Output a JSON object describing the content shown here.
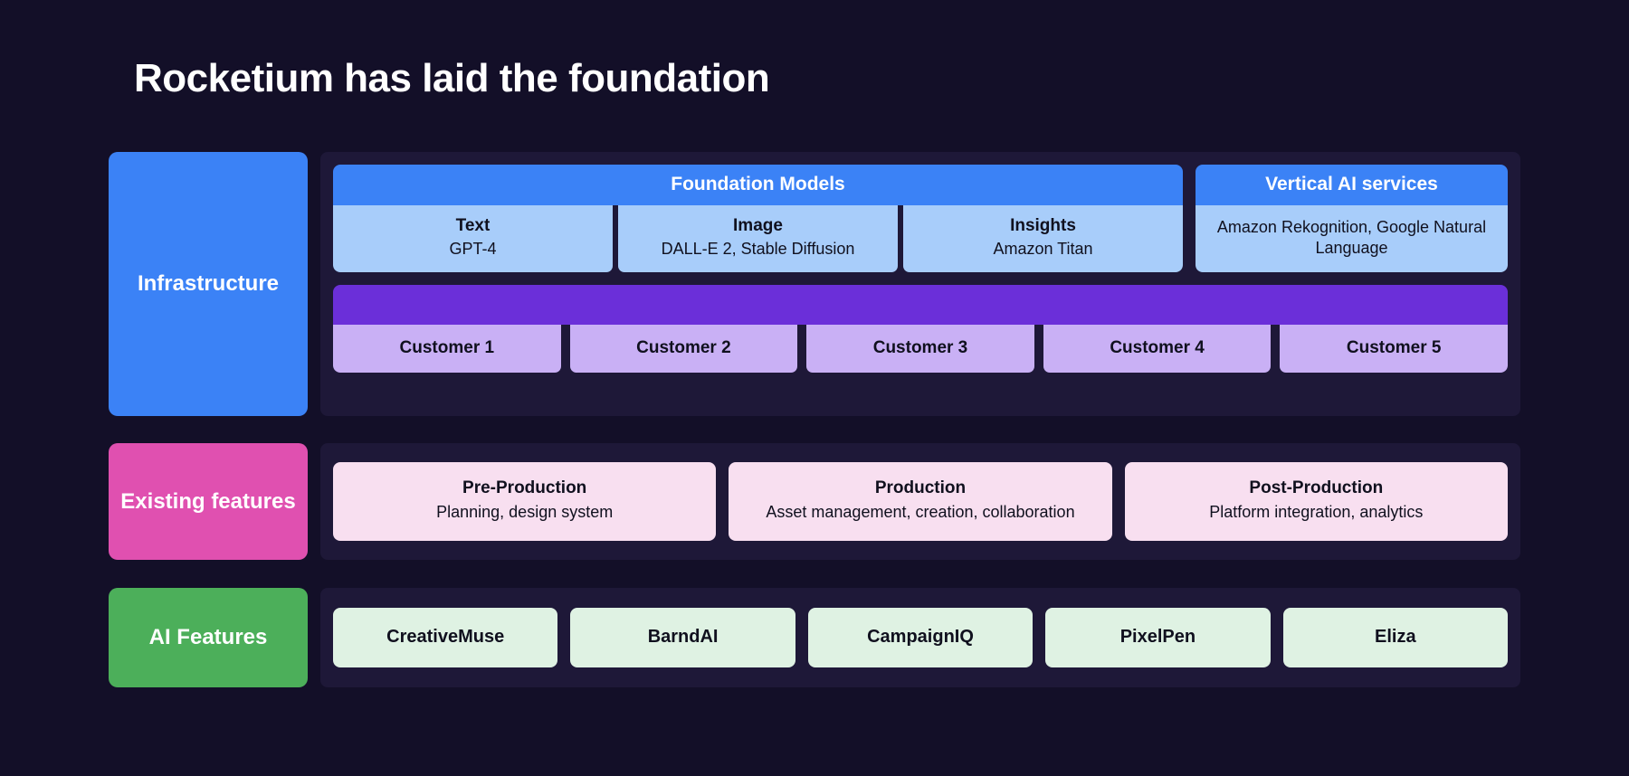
{
  "title": "Rocketium has laid the foundation",
  "colors": {
    "background": "#130f28",
    "row_panel": "#1e1838",
    "infrastructure": "#3b82f6",
    "existing_features": "#e050b0",
    "ai_features": "#4caf5a",
    "foundation_header": "#3b82f6",
    "foundation_cell": "#a8cdfa",
    "customer_bar": "#6b2fd9",
    "customer_cell": "#c9b0f5",
    "existing_cell": "#f8dff0",
    "ai_cell": "#dff2e3"
  },
  "rows": {
    "infrastructure": {
      "label": "Infrastructure",
      "groups": [
        {
          "header": "Foundation Models",
          "items": [
            {
              "title": "Text",
              "sub": "GPT-4"
            },
            {
              "title": "Image",
              "sub": "DALL-E 2, Stable Diffusion"
            },
            {
              "title": "Insights",
              "sub": "Amazon Titan"
            }
          ]
        },
        {
          "header": "Vertical AI services",
          "items": [
            {
              "title": "",
              "sub": "Amazon Rekognition, Google Natural Language"
            }
          ]
        }
      ],
      "customers": [
        {
          "label": "Customer 1"
        },
        {
          "label": "Customer 2"
        },
        {
          "label": "Customer 3"
        },
        {
          "label": "Customer 4"
        },
        {
          "label": "Customer 5"
        }
      ]
    },
    "existing_features": {
      "label": "Existing features",
      "items": [
        {
          "title": "Pre-Production",
          "sub": "Planning, design system"
        },
        {
          "title": "Production",
          "sub": "Asset management, creation, collaboration"
        },
        {
          "title": "Post-Production",
          "sub": "Platform integration, analytics"
        }
      ]
    },
    "ai_features": {
      "label": "AI Features",
      "items": [
        {
          "label": "CreativeMuse"
        },
        {
          "label": "BarndAI"
        },
        {
          "label": "CampaignIQ"
        },
        {
          "label": "PixelPen"
        },
        {
          "label": "Eliza"
        }
      ]
    }
  }
}
